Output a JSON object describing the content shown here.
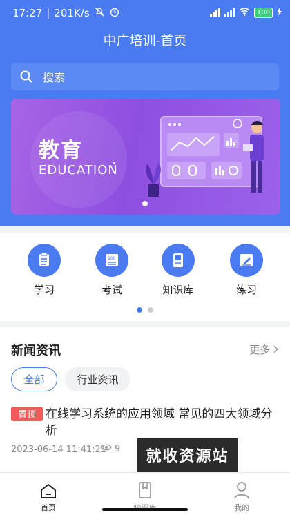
{
  "status": {
    "time": "17:27",
    "speed": "201K/s",
    "battery": "100"
  },
  "header": {
    "title": "中广培训-首页"
  },
  "search": {
    "placeholder": "搜索"
  },
  "banner": {
    "title": "教育",
    "subtitle": "EDUCATION"
  },
  "menu": {
    "items": [
      {
        "label": "学习",
        "icon": "study-icon"
      },
      {
        "label": "考试",
        "icon": "exam-icon"
      },
      {
        "label": "知识库",
        "icon": "knowledge-icon"
      },
      {
        "label": "练习",
        "icon": "practice-icon"
      }
    ]
  },
  "news": {
    "title": "新闻资讯",
    "more": "更多",
    "tabs": [
      "全部",
      "行业资讯"
    ],
    "items": [
      {
        "badge": "置顶",
        "title": "在线学习系统的应用领域 常见的四大领域分析",
        "date": "2023-06-14 11:41:21",
        "views": "9"
      }
    ]
  },
  "watermark": "就收资源站",
  "tabbar": {
    "items": [
      {
        "label": "首页",
        "active": true
      },
      {
        "label": "知识库",
        "active": false
      },
      {
        "label": "我的",
        "active": false
      }
    ]
  },
  "colors": {
    "primary": "#4a7bf3",
    "badge": "#f05a5a"
  }
}
